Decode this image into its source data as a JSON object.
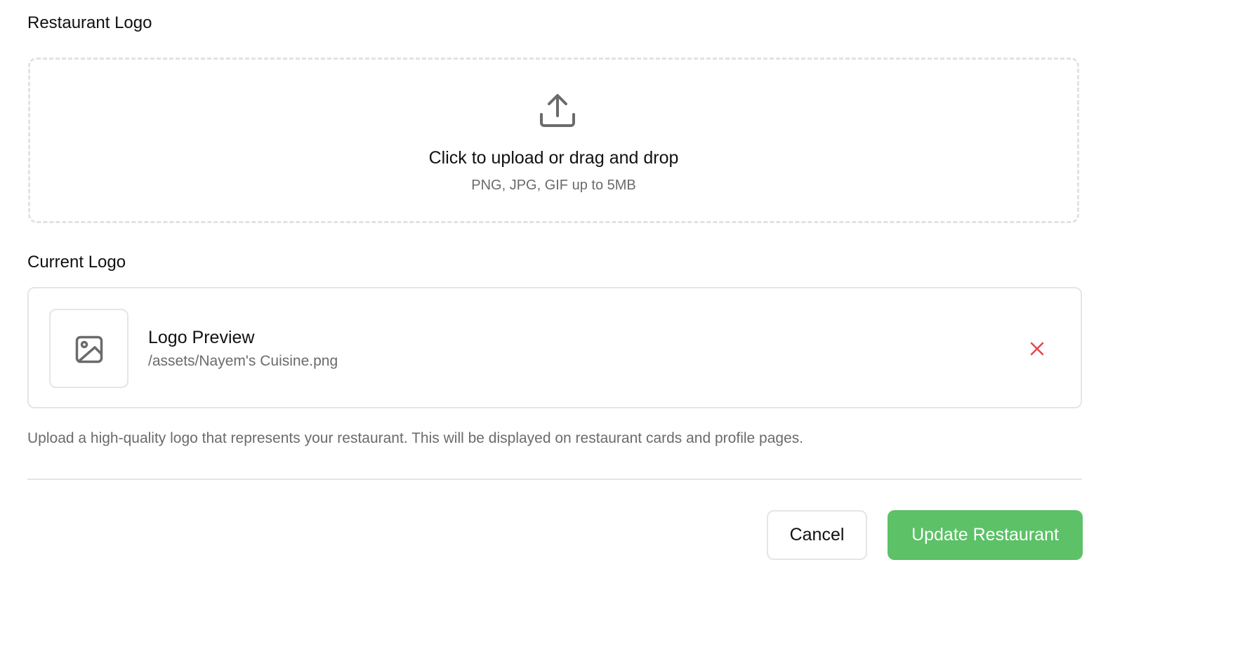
{
  "upload_section": {
    "title": "Restaurant Logo",
    "dropzone": {
      "icon": "upload-icon",
      "prompt": "Click to upload or drag and drop",
      "hint": "PNG, JPG, GIF up to 5MB"
    }
  },
  "current_section": {
    "title": "Current Logo",
    "preview": {
      "icon": "image-icon",
      "name": "Logo Preview",
      "path": "/assets/Nayem's Cuisine.png",
      "remove_icon": "close-icon",
      "remove_color": "#e5484d"
    }
  },
  "helper_text": "Upload a high-quality logo that represents your restaurant. This will be displayed on restaurant cards and profile pages.",
  "actions": {
    "cancel_label": "Cancel",
    "submit_label": "Update Restaurant",
    "submit_color": "#5cc167"
  }
}
